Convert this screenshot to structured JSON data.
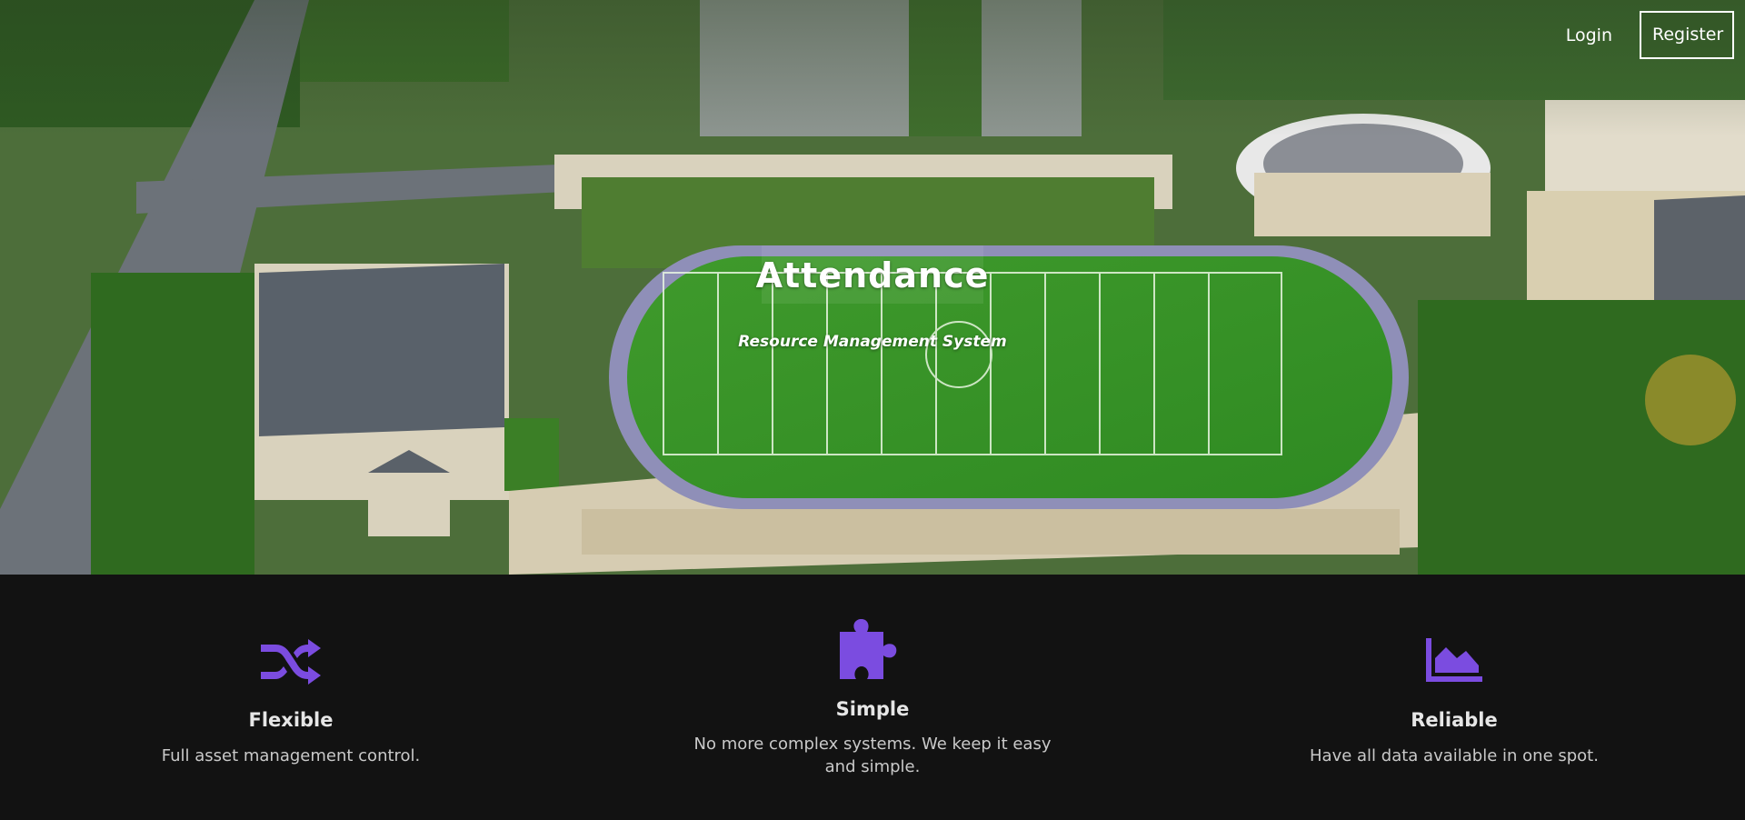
{
  "nav": {
    "login_label": "Login",
    "register_label": "Register"
  },
  "hero": {
    "title": "Attendance",
    "subtitle": "Resource Management System"
  },
  "features": [
    {
      "icon": "shuffle-icon",
      "title": "Flexible",
      "text": "Full asset management control."
    },
    {
      "icon": "puzzle-icon",
      "title": "Simple",
      "text": "No more complex systems. We keep it easy and simple."
    },
    {
      "icon": "area-chart-icon",
      "title": "Reliable",
      "text": "Have all data available in one spot."
    }
  ],
  "colors": {
    "accent": "#7b4ce0",
    "footer_bg": "#121212"
  }
}
